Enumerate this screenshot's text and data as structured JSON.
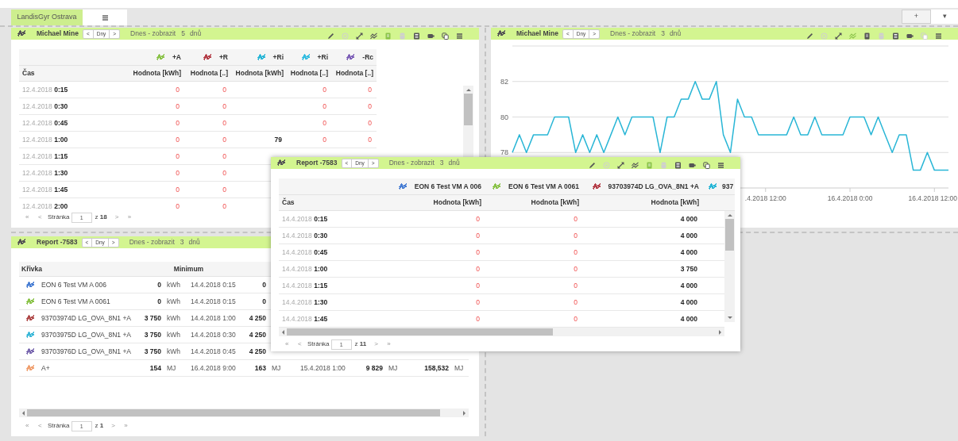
{
  "tabs": [
    {
      "label": "LandisGyr Ostrava",
      "selected": true
    }
  ],
  "tab_bar_buttons": [
    "+",
    "▾"
  ],
  "panels": [
    {
      "kind": "table",
      "floating": false,
      "title": "Michael Mine",
      "nav": [
        "<",
        "Dny",
        ">"
      ],
      "period_label": "Dnes - zobrazit",
      "period_count": "5",
      "period_unit": "dnů",
      "toolbar": [
        {
          "active": false,
          "disabled": false
        },
        {
          "active": false,
          "disabled": true
        },
        {
          "active": false,
          "disabled": false
        },
        {
          "active": false,
          "disabled": false
        },
        {
          "active": true,
          "disabled": false
        },
        {
          "active": false,
          "disabled": true
        },
        {
          "active": false,
          "disabled": false
        },
        {
          "active": false,
          "disabled": false
        },
        {
          "active": false,
          "disabled": false
        },
        {
          "active": false,
          "disabled": false
        }
      ],
      "series": [
        {
          "name": "+A",
          "color": "#8bc34a"
        },
        {
          "name": "+R",
          "color": "#b5404a"
        },
        {
          "name": "+Ri",
          "color": "#29b6d6"
        },
        {
          "name": "+Ri",
          "color": "#35bde0"
        },
        {
          "name": "-Rc",
          "color": "#7e60b8"
        }
      ],
      "columns": [
        "Čas",
        "Hodnota [kWh]",
        "Hodnota [..]",
        "Hodnota [kWh]",
        "Hodnota [..]",
        "Hodnota [..]"
      ],
      "rows": [
        {
          "time": "12.4.2018 **0:15**",
          "cells": {
            "column_1": {
              "text": "0",
              "flagged": true
            },
            "column_2": {
              "text": "0",
              "flagged": true
            },
            "column_4": {
              "text": "0",
              "flagged": true
            },
            "column_5": {
              "text": "0",
              "flagged": true
            }
          }
        },
        {
          "time": "12.4.2018 **0:30**",
          "cells": {
            "column_1": {
              "text": "0",
              "flagged": true
            },
            "column_2": {
              "text": "0",
              "flagged": true
            },
            "column_4": {
              "text": "0",
              "flagged": true
            },
            "column_5": {
              "text": "0",
              "flagged": true
            }
          }
        },
        {
          "time": "12.4.2018 **0:45**",
          "cells": {
            "column_1": {
              "text": "0",
              "flagged": true
            },
            "column_2": {
              "text": "0",
              "flagged": true
            },
            "column_4": {
              "text": "0",
              "flagged": true
            },
            "column_5": {
              "text": "0",
              "flagged": true
            }
          }
        },
        {
          "time": "12.4.2018 **1:00**",
          "cells": {
            "column_1": {
              "text": "0",
              "flagged": true
            },
            "column_2": {
              "text": "0",
              "flagged": true
            },
            "column_3": {
              "text": "79",
              "flagged": false
            },
            "column_4": {
              "text": "0",
              "flagged": true
            },
            "column_5": {
              "text": "0",
              "flagged": true
            }
          }
        },
        {
          "time": "12.4.2018 **1:15**",
          "cells": {
            "column_1": {
              "text": "0",
              "flagged": true
            },
            "column_2": {
              "text": "0",
              "flagged": true
            }
          }
        },
        {
          "time": "12.4.2018 **1:30**",
          "cells": {
            "column_1": {
              "text": "0",
              "flagged": true
            },
            "column_2": {
              "text": "0",
              "flagged": true
            }
          }
        },
        {
          "time": "12.4.2018 **1:45**",
          "cells": {
            "column_1": {
              "text": "0",
              "flagged": true
            },
            "column_2": {
              "text": "0",
              "flagged": true
            }
          }
        },
        {
          "time": "12.4.2018 **2:00**",
          "cells": {
            "column_1": {
              "text": "0",
              "flagged": true
            },
            "column_2": {
              "text": "0",
              "flagged": true
            }
          }
        }
      ],
      "pager": {
        "first": "«",
        "prev": "<",
        "label": "Stránka",
        "page": "1",
        "of": "z **18**",
        "next": ">",
        "last": "»"
      }
    },
    {
      "kind": "chart",
      "floating": false,
      "title": "Michael Mine",
      "nav": [
        "<",
        "Dny",
        ">"
      ],
      "period_label": "Dnes - zobrazit",
      "period_count": "3",
      "period_unit": "dnů",
      "toolbar": [
        {
          "active": false,
          "disabled": false
        },
        {
          "active": false,
          "disabled": true
        },
        {
          "active": false,
          "disabled": false
        },
        {
          "active": true,
          "disabled": false
        },
        {
          "active": false,
          "disabled": false
        },
        {
          "active": false,
          "disabled": true
        },
        {
          "active": false,
          "disabled": false
        },
        {
          "active": false,
          "disabled": false
        },
        {
          "active": false,
          "disabled": true
        },
        {
          "active": false,
          "disabled": false
        }
      ],
      "x_axis_labels": [
        ".4.2018 12:00",
        "16.4.2018 0:00",
        "16.4.2018 12:00"
      ],
      "chart_data": {
        "type": "line",
        "grid": true,
        "ylim": [
          76,
          84
        ],
        "yticks": [
          78,
          80,
          82
        ],
        "series": [
          {
            "color": "#29b6d6",
            "values": [
              78,
              79,
              78,
              79,
              79,
              79,
              80,
              80,
              80,
              78,
              79,
              78,
              79,
              78,
              79,
              80,
              79,
              80,
              80,
              80,
              80,
              78,
              80,
              80,
              81,
              81,
              82,
              81,
              81,
              82,
              79,
              78,
              81,
              80,
              80,
              79,
              79,
              79,
              79,
              79,
              80,
              79,
              79,
              80,
              79,
              79,
              79,
              79,
              80,
              80,
              80,
              79,
              80,
              79,
              78,
              79,
              79,
              77,
              77,
              78,
              77,
              77,
              77
            ]
          }
        ]
      }
    },
    {
      "kind": "summary",
      "floating": false,
      "title": "Report -7583",
      "nav": [
        "<",
        "Dny",
        ">"
      ],
      "period_label": "Dnes - zobrazit",
      "period_count": "3",
      "period_unit": "dnů",
      "columns": [
        "Křivka",
        "Minimum"
      ],
      "rows": [
        {
          "name": "EON 6 Test VM A 006",
          "color": "#4a7fd4",
          "cells": [
            "0",
            "kWh",
            "14.4.2018 0:15",
            "0"
          ]
        },
        {
          "name": "EON 6 Test VM A 0061",
          "color": "#8bc34a",
          "cells": [
            "0",
            "kWh",
            "14.4.2018 0:15",
            "0"
          ]
        },
        {
          "name": "93703974D LG_OVA_8N1 +A",
          "color": "#b04a4a",
          "cells": [
            "3 750",
            "kWh",
            "14.4.2018 1:00",
            "4 250"
          ]
        },
        {
          "name": "93703975D LG_OVA_8N1 +A",
          "color": "#3bb8d8",
          "cells": [
            "3 750",
            "kWh",
            "14.4.2018 0:30",
            "4 250"
          ]
        },
        {
          "name": "93703976D LG_OVA_8N1 +A",
          "color": "#7a68b0",
          "cells": [
            "3 750",
            "kWh",
            "14.4.2018 0:45",
            "4 250"
          ]
        },
        {
          "name": "A+",
          "color": "#f0a070",
          "cells": [
            "154",
            "MJ",
            "16.4.2018 9:00",
            "163",
            "MJ",
            "15.4.2018 1:00",
            "9 829",
            "MJ",
            "158,532",
            "MJ"
          ]
        }
      ],
      "pager": {
        "first": "«",
        "prev": "<",
        "label": "Stránka",
        "page": "1",
        "of": "z **1**",
        "next": ">",
        "last": "»"
      }
    },
    {
      "kind": "table",
      "floating": true,
      "title": "Report -7583",
      "nav": [
        "<",
        "Dny",
        ">"
      ],
      "period_label": "Dnes - zobrazit",
      "period_count": "3",
      "period_unit": "dnů",
      "toolbar": [
        {
          "active": false,
          "disabled": false
        },
        {
          "active": false,
          "disabled": true
        },
        {
          "active": false,
          "disabled": false
        },
        {
          "active": false,
          "disabled": false
        },
        {
          "active": true,
          "disabled": false
        },
        {
          "active": false,
          "disabled": true
        },
        {
          "active": false,
          "disabled": false
        },
        {
          "active": false,
          "disabled": false
        },
        {
          "active": false,
          "disabled": false
        },
        {
          "active": false,
          "disabled": false
        }
      ],
      "series": [
        {
          "name": "EON 6 Test VM A 006",
          "color": "#4a7fd4"
        },
        {
          "name": "EON 6 Test VM A 0061",
          "color": "#8bc34a"
        },
        {
          "name": "93703974D LG_OVA_8N1 +A",
          "color": "#b5404a"
        },
        {
          "name": "937",
          "color": "#29b6d6"
        }
      ],
      "columns": [
        "Čas",
        "Hodnota [kWh]",
        "Hodnota [kWh]",
        "Hodnota [kWh]"
      ],
      "rows": [
        {
          "time": "14.4.2018 **0:15**",
          "cells": {
            "column_1": {
              "text": "0",
              "flagged": true
            },
            "column_2": {
              "text": "0",
              "flagged": true
            },
            "column_3": {
              "text": "4 000",
              "flagged": false
            }
          }
        },
        {
          "time": "14.4.2018 **0:30**",
          "cells": {
            "column_1": {
              "text": "0",
              "flagged": true
            },
            "column_2": {
              "text": "0",
              "flagged": true
            },
            "column_3": {
              "text": "4 000",
              "flagged": false
            }
          }
        },
        {
          "time": "14.4.2018 **0:45**",
          "cells": {
            "column_1": {
              "text": "0",
              "flagged": true
            },
            "column_2": {
              "text": "0",
              "flagged": true
            },
            "column_3": {
              "text": "4 000",
              "flagged": false
            }
          }
        },
        {
          "time": "14.4.2018 **1:00**",
          "cells": {
            "column_1": {
              "text": "0",
              "flagged": true
            },
            "column_2": {
              "text": "0",
              "flagged": true
            },
            "column_3": {
              "text": "3 750",
              "flagged": false
            }
          }
        },
        {
          "time": "14.4.2018 **1:15**",
          "cells": {
            "column_1": {
              "text": "0",
              "flagged": true
            },
            "column_2": {
              "text": "0",
              "flagged": true
            },
            "column_3": {
              "text": "4 000",
              "flagged": false
            }
          }
        },
        {
          "time": "14.4.2018 **1:30**",
          "cells": {
            "column_1": {
              "text": "0",
              "flagged": true
            },
            "column_2": {
              "text": "0",
              "flagged": true
            },
            "column_3": {
              "text": "4 000",
              "flagged": false
            }
          }
        },
        {
          "time": "14.4.2018 **1:45**",
          "cells": {
            "column_1": {
              "text": "0",
              "flagged": true
            },
            "column_2": {
              "text": "0",
              "flagged": true
            },
            "column_3": {
              "text": "4 000",
              "flagged": false
            }
          }
        }
      ],
      "pager": {
        "first": "«",
        "prev": "<",
        "label": "Stránka",
        "page": "1",
        "of": "z **11**",
        "next": ">",
        "last": "»"
      }
    }
  ]
}
